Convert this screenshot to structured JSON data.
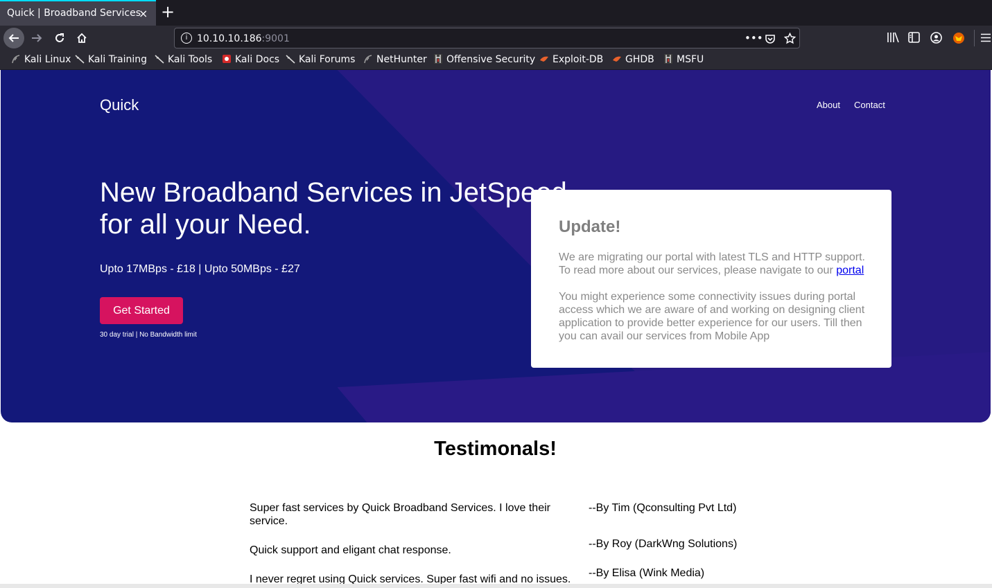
{
  "browser": {
    "tab_title": "Quick | Broadband Services",
    "tab_close": "×",
    "new_tab": "+",
    "url_host": "10.10.10.186",
    "url_port": ":9001",
    "bookmarks": [
      {
        "label": "Kali Linux",
        "icon": "kali-dragon-icon"
      },
      {
        "label": "Kali Training",
        "icon": "kali-dragon-icon"
      },
      {
        "label": "Kali Tools",
        "icon": "kali-dragon-icon"
      },
      {
        "label": "Kali Docs",
        "icon": "kali-docs-icon"
      },
      {
        "label": "Kali Forums",
        "icon": "kali-dragon-icon"
      },
      {
        "label": "NetHunter",
        "icon": "kali-dragon-icon"
      },
      {
        "label": "Offensive Security",
        "icon": "offsec-icon"
      },
      {
        "label": "Exploit-DB",
        "icon": "exploit-db-icon"
      },
      {
        "label": "GHDB",
        "icon": "exploit-db-icon"
      },
      {
        "label": "MSFU",
        "icon": "offsec-icon"
      }
    ]
  },
  "page": {
    "brand": "Quick",
    "nav": {
      "about": "About",
      "contact": "Contact"
    },
    "headline_line1": "New Broadband Services in JetSpeed",
    "headline_line2": "for all your Need.",
    "pricing": "Upto 17MBps - £18 | Upto 50MBps - £27",
    "cta": "Get Started",
    "trial": "30 day trial | No Bandwidth limit",
    "update": {
      "title": "Update!",
      "p1_text": "We are migrating our portal with latest TLS and HTTP support. To read more about our services, please navigate to our ",
      "p1_link": "portal",
      "p2": "You might experience some connectivity issues during portal access which we are aware of and working on designing client application to provide better experience for our users. Till then you can avail our services from Mobile App"
    },
    "testimonials_title": "Testimonals!",
    "testimonials": [
      {
        "quote": "Super fast services by Quick Broadband Services. I love their service.",
        "author": "--By Tim (Qconsulting Pvt Ltd)"
      },
      {
        "quote": "Quick support and eligant chat response.",
        "author": "--By Roy (DarkWng Solutions)"
      },
      {
        "quote": "I never regret using Quick services. Super fast wifi and no issues.",
        "author": "--By Elisa (Wink Media)"
      }
    ]
  },
  "colors": {
    "hero_bg": "#13187a",
    "cta_bg": "#d6135f",
    "link": "#0000ee"
  }
}
